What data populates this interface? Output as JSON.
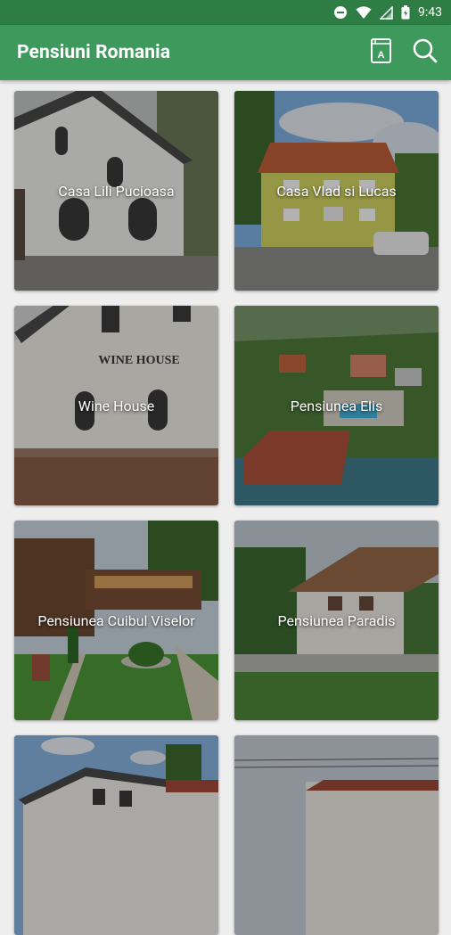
{
  "status_bar": {
    "time": "9:43",
    "icons": [
      "do-not-disturb-icon",
      "wifi-icon",
      "signal-icon",
      "battery-icon"
    ]
  },
  "app_bar": {
    "title": "Pensiuni Romania",
    "actions": [
      "translate-book-icon",
      "search-icon"
    ],
    "color": "#3d9a5c"
  },
  "listings": [
    {
      "name": "Casa Lili Pucioasa"
    },
    {
      "name": "Casa Vlad si Lucas"
    },
    {
      "name": "Wine House"
    },
    {
      "name": "Pensiunea Elis"
    },
    {
      "name": "Pensiunea Cuibul Viselor"
    },
    {
      "name": "Pensiunea Paradis"
    },
    {
      "name": ""
    },
    {
      "name": ""
    }
  ]
}
